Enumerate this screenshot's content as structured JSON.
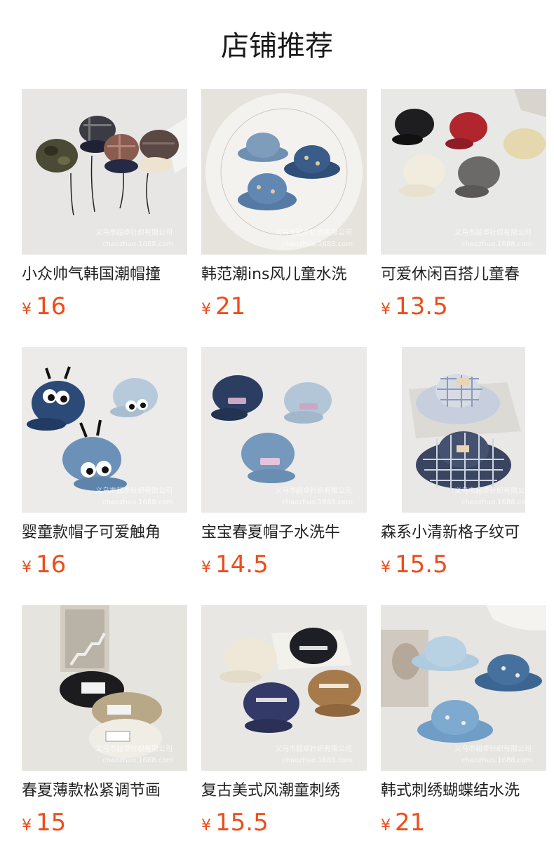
{
  "header": {
    "title": "店铺推荐"
  },
  "currency_symbol": "¥",
  "watermark": {
    "line1": "义乌市超卓针织有限公司",
    "line2": "chaozhuo.1688.com"
  },
  "products": [
    {
      "name": "小众帅气韩国潮帽撞",
      "price": "16",
      "image_icon": "camo-plaid-caps-icon"
    },
    {
      "name": "韩范潮ins风儿童水洗",
      "price": "21",
      "image_icon": "denim-bucket-hats-icon"
    },
    {
      "name": "可爱休闲百搭儿童春",
      "price": "13.5",
      "image_icon": "embroidered-baseball-caps-icon"
    },
    {
      "name": "婴童款帽子可爱触角",
      "price": "16",
      "image_icon": "antenna-eye-caps-icon"
    },
    {
      "name": "宝宝春夏帽子水洗牛",
      "price": "14.5",
      "image_icon": "washed-denim-caps-icon"
    },
    {
      "name": "森系小清新格子纹可",
      "price": "15.5",
      "image_icon": "plaid-sun-hats-icon"
    },
    {
      "name": "春夏薄款松紧调节画",
      "price": "15",
      "image_icon": "painter-berets-icon"
    },
    {
      "name": "复古美式风潮童刺绣",
      "price": "15.5",
      "image_icon": "retro-flat-brim-caps-icon"
    },
    {
      "name": "韩式刺绣蝴蝶结水洗",
      "price": "21",
      "image_icon": "bow-denim-bucket-hats-icon"
    }
  ]
}
